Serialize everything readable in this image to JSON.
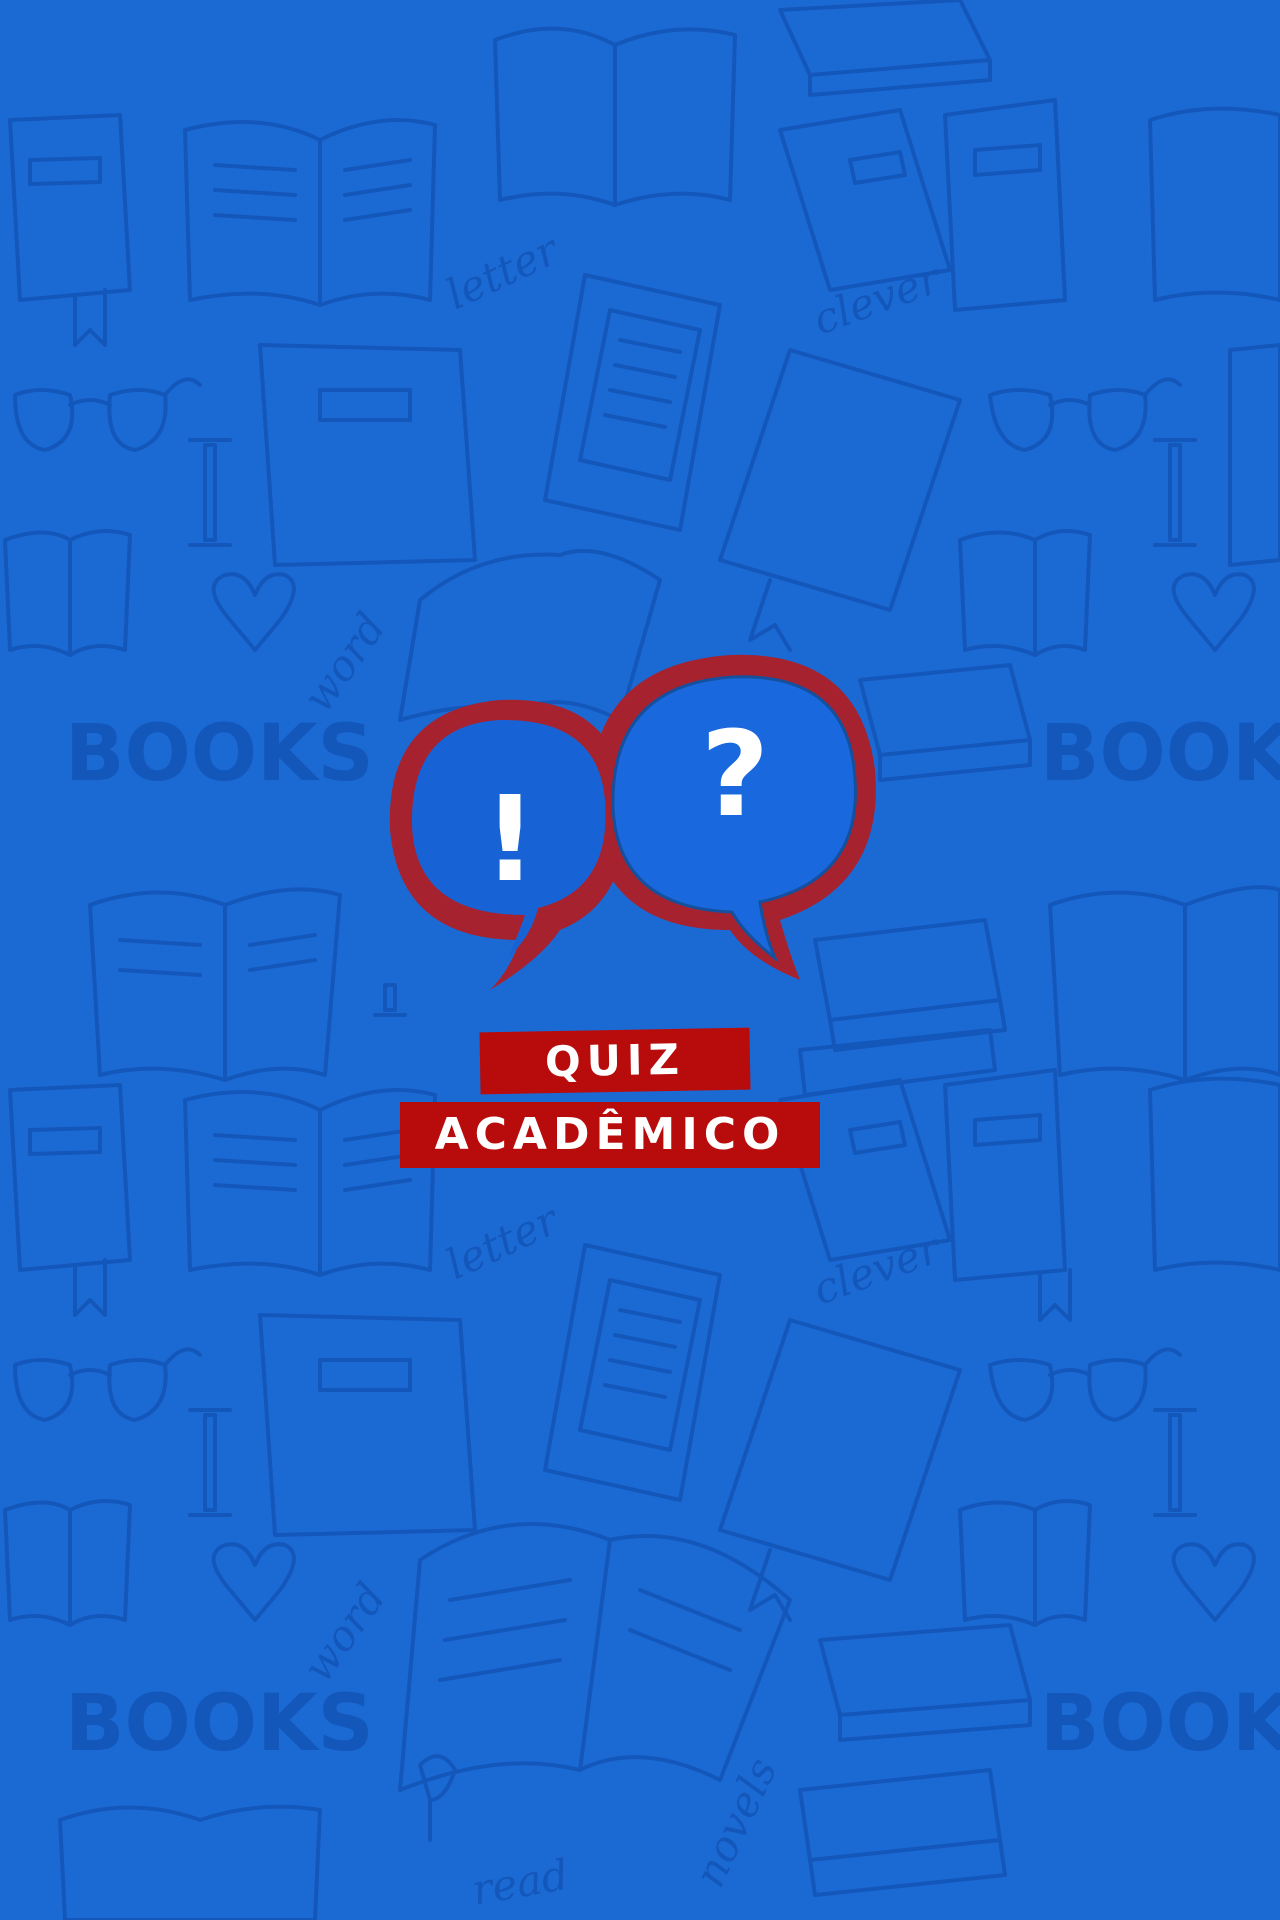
{
  "colors": {
    "background": "#1b6ad4",
    "pattern_ink": "#1455b8",
    "bubble_blue": "#1763d6",
    "bubble_outline": "#a5222e",
    "banner_red": "#b80c0c",
    "text_white": "#ffffff"
  },
  "background": {
    "pattern_words": [
      "BOOKS",
      "BOOKS",
      "letter",
      "clever",
      "word",
      "BOOKS",
      "BOOKS",
      "letter",
      "clever",
      "word",
      "novels",
      "read"
    ],
    "icons": [
      "open-book-icon",
      "closed-book-icon",
      "e-reader-icon",
      "glasses-icon",
      "heart-icon",
      "lamp-icon",
      "book-stack-icon"
    ]
  },
  "logo": {
    "left_bubble_glyph": "!",
    "right_bubble_glyph": "?",
    "title_line_1": "QUIZ",
    "title_line_2": "ACADÊMICO"
  }
}
